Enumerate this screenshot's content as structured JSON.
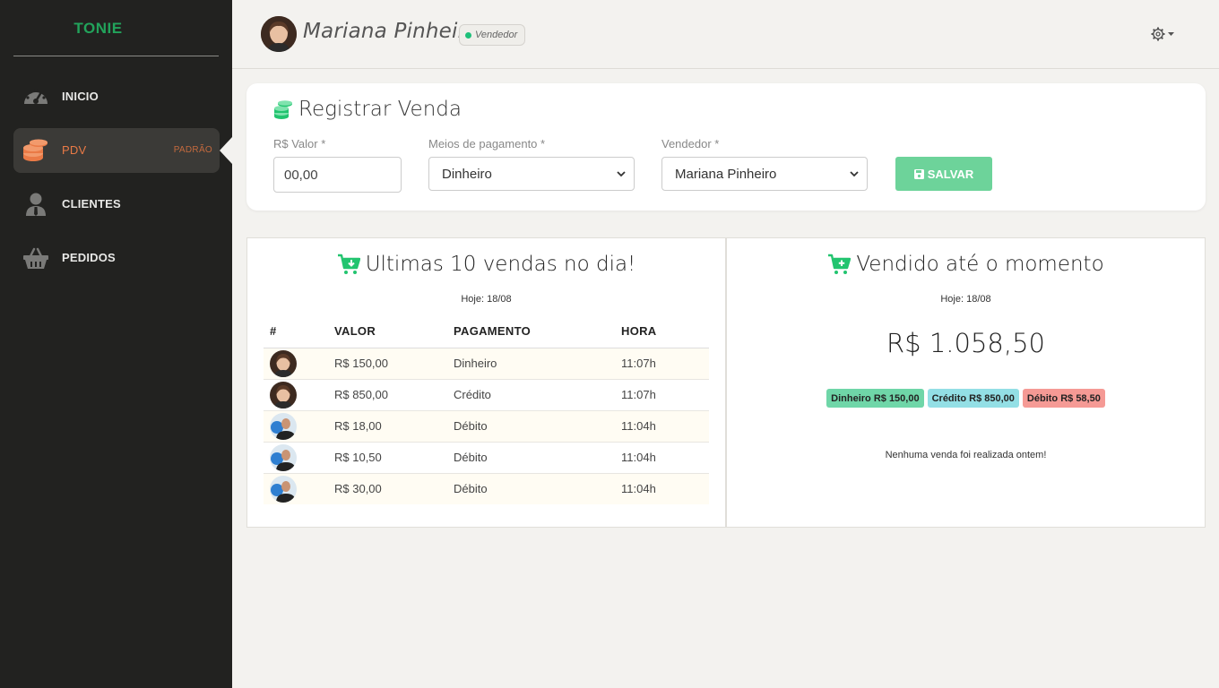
{
  "brand": "TONIE",
  "sidebar": {
    "items": [
      {
        "label": "INICIO",
        "icon": "speedometer-icon"
      },
      {
        "label": "PDV",
        "icon": "coins-icon",
        "badge": "PADRÃO",
        "active": true
      },
      {
        "label": "CLIENTES",
        "icon": "user-tie-icon"
      },
      {
        "label": "PEDIDOS",
        "icon": "basket-icon"
      }
    ]
  },
  "header": {
    "user_name": "Mariana Pinheiro",
    "role": "Vendedor"
  },
  "register": {
    "title": "Registrar Venda",
    "value_label": "R$ Valor *",
    "value_placeholder": "00,00",
    "payment_label": "Meios de pagamento *",
    "payment_selected": "Dinheiro",
    "seller_label": "Vendedor *",
    "seller_selected": "Mariana Pinheiro",
    "save_label": "SALVAR"
  },
  "recent": {
    "title": "Ultimas 10 vendas no dia!",
    "date_text": "Hoje: 18/08",
    "columns": [
      "#",
      "VALOR",
      "PAGAMENTO",
      "HORA"
    ],
    "rows": [
      {
        "avatar": "woman",
        "valor": "R$ 150,00",
        "pagamento": "Dinheiro",
        "hora": "11:07h"
      },
      {
        "avatar": "woman",
        "valor": "R$ 850,00",
        "pagamento": "Crédito",
        "hora": "11:07h"
      },
      {
        "avatar": "man",
        "valor": "R$ 18,00",
        "pagamento": "Débito",
        "hora": "11:04h"
      },
      {
        "avatar": "man",
        "valor": "R$ 10,50",
        "pagamento": "Débito",
        "hora": "11:04h"
      },
      {
        "avatar": "man",
        "valor": "R$ 30,00",
        "pagamento": "Débito",
        "hora": "11:04h"
      }
    ]
  },
  "summary": {
    "title": "Vendido até o momento",
    "date_text": "Hoje: 18/08",
    "total": "R$ 1.058,50",
    "tags": [
      {
        "label": "Dinheiro R$ 150,00",
        "color": "#6fd6a8"
      },
      {
        "label": "Crédito R$ 850,00",
        "color": "#93dfe5"
      },
      {
        "label": "Débito R$ 58,50",
        "color": "#f59a95"
      }
    ],
    "no_sales_text": "Nenhuma venda foi realizada ontem!"
  },
  "colors": {
    "brand": "#22a35b",
    "sidebar_bg": "#222220",
    "active_nav": "#ea7a46",
    "save_button": "#6dd39a",
    "icon_green": "#22c46f"
  }
}
